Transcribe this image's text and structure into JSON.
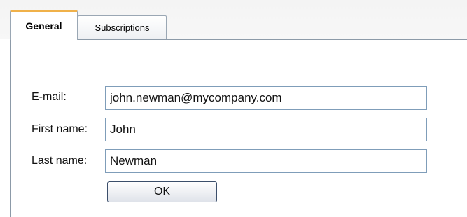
{
  "tabs": {
    "general": "General",
    "subscriptions": "Subscriptions"
  },
  "form": {
    "email_label": "E-mail:",
    "email_value": "john.newman@mycompany.com",
    "first_name_label": "First name:",
    "first_name_value": "John",
    "last_name_label": "Last name:",
    "last_name_value": "Newman",
    "ok_label": "OK"
  },
  "colors": {
    "active_tab_accent": "#f0b14a",
    "field_border": "#7f9db9"
  }
}
